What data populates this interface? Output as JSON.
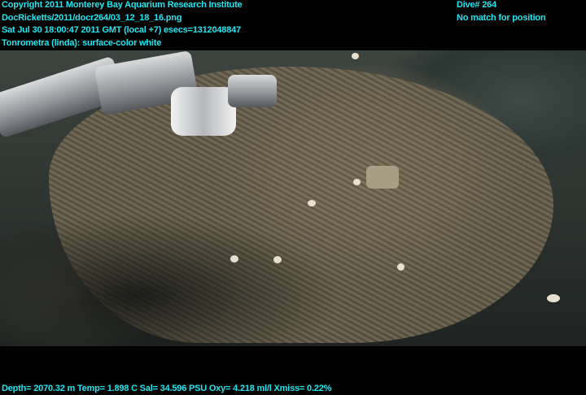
{
  "header_left": [
    "Copyright 2011 Monterey Bay Aquarium Research Institute",
    "DocRicketts/2011/docr264/03_12_18_16.png",
    "Sat Jul 30 18:00:47 2011 GMT (local +7)  esecs=1312048847",
    "Tonrometra (linda): surface-color white"
  ],
  "header_right": [
    "Dive# 264",
    "No match for position"
  ],
  "footer": "Depth= 2070.32 m  Temp= 1.898 C  Sal= 34.596 PSU  Oxy= 4.218 ml/l  Xmiss= 0.22%",
  "colors": {
    "overlay_text": "#1fe6ef",
    "background": "#000000"
  }
}
